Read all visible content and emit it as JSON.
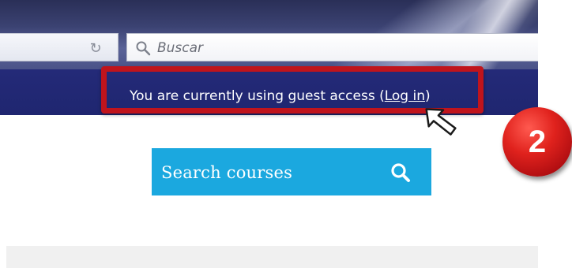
{
  "browser": {
    "search_placeholder": "Buscar",
    "reload_icon": "reload-icon",
    "search_icon": "magnifier-icon"
  },
  "navbar": {
    "guest_text": "You are currently using guest access (",
    "login_link": "Log in",
    "guest_text_end": ")",
    "background": "#232a76"
  },
  "annotation": {
    "step_number": "2",
    "highlight_color": "#c0141c",
    "cursor_icon": "cursor-arrow-icon"
  },
  "main": {
    "search_courses_label": "Search courses",
    "search_courses_icon": "search-icon",
    "accent_color": "#1ba8df"
  }
}
